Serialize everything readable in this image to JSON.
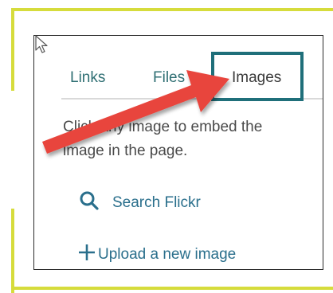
{
  "tabs": {
    "links": "Links",
    "files": "Files",
    "images": "Images"
  },
  "description": "Click any image to embed the image in the page.",
  "actions": {
    "search_label": "Search Flickr",
    "search_icon": "search-icon",
    "upload_label": "Upload a new image",
    "upload_icon": "plus-icon"
  },
  "colors": {
    "accent": "#2f6f73",
    "highlight_box": "#1f6f7a",
    "annotation_arrow": "#e8453c",
    "annotation_bracket": "#d6dc3c"
  }
}
